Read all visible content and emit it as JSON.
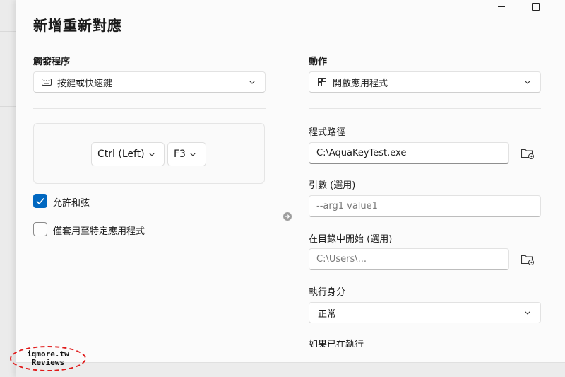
{
  "dialog": {
    "title": "新增重新對應",
    "window_controls": {
      "minimize": "minimize-icon",
      "maximize": "maximize-icon"
    }
  },
  "trigger": {
    "section_label": "觸發程序",
    "type_value": "按鍵或快速鍵",
    "keys": [
      {
        "label": "Ctrl (Left)"
      },
      {
        "label": "F3"
      }
    ],
    "allow_chords": {
      "label": "允許和弦",
      "checked": true
    },
    "app_specific": {
      "label": "僅套用至特定應用程式",
      "checked": false
    }
  },
  "action": {
    "section_label": "動作",
    "type_value": "開啟應用程式",
    "program_path": {
      "label": "程式路徑",
      "value": "C:\\AquaKeyTest.exe"
    },
    "arguments": {
      "label": "引數 (選用)",
      "placeholder": "--arg1 value1"
    },
    "start_in": {
      "label": "在目錄中開始 (選用)",
      "placeholder": "C:\\Users\\..."
    },
    "run_as": {
      "label": "執行身分",
      "value": "正常"
    },
    "if_running": {
      "label": "如果已在執行"
    }
  },
  "watermark": {
    "line1": "iqmore.tw",
    "line2": "Reviews"
  },
  "colors": {
    "accent": "#0067c0",
    "watermark_ring": "#e01a1a"
  }
}
